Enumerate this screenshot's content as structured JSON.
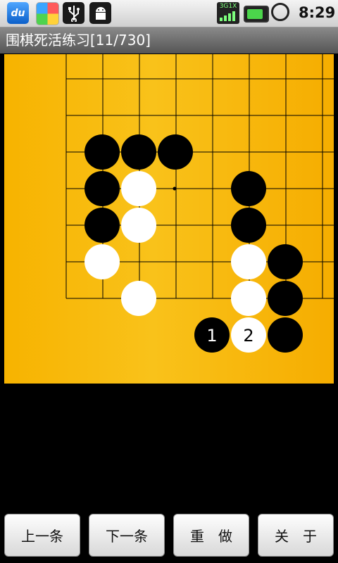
{
  "status_bar": {
    "icons": [
      "du-app-icon",
      "colorful-app-icon",
      "usb-icon",
      "android-debug-icon",
      "3g-signal-icon",
      "battery-charging-icon",
      "alarm-clock-icon"
    ],
    "du_label": "du",
    "signal_label": "3G1X",
    "time": "8:29"
  },
  "title": "围棋死活练习[11/730]",
  "board": {
    "colors": {
      "background": "#f7b300",
      "line": "#000000",
      "black": "#000000",
      "white": "#ffffff"
    },
    "stones": [
      {
        "col": 0,
        "row": 1,
        "color": "black"
      },
      {
        "col": 1,
        "row": 1,
        "color": "black"
      },
      {
        "col": 2,
        "row": 1,
        "color": "black"
      },
      {
        "col": 0,
        "row": 2,
        "color": "black"
      },
      {
        "col": 1,
        "row": 2,
        "color": "white"
      },
      {
        "col": 4,
        "row": 2,
        "color": "black"
      },
      {
        "col": 0,
        "row": 3,
        "color": "black"
      },
      {
        "col": 1,
        "row": 3,
        "color": "white"
      },
      {
        "col": 4,
        "row": 3,
        "color": "black"
      },
      {
        "col": 0,
        "row": 4,
        "color": "white"
      },
      {
        "col": 4,
        "row": 4,
        "color": "white"
      },
      {
        "col": 5,
        "row": 4,
        "color": "black"
      },
      {
        "col": 1,
        "row": 5,
        "color": "white"
      },
      {
        "col": 4,
        "row": 5,
        "color": "white"
      },
      {
        "col": 5,
        "row": 5,
        "color": "black"
      },
      {
        "col": 3,
        "row": 6,
        "color": "black",
        "label": "1"
      },
      {
        "col": 4,
        "row": 6,
        "color": "white",
        "label": "2"
      },
      {
        "col": 5,
        "row": 6,
        "color": "black"
      }
    ]
  },
  "buttons": [
    {
      "name": "prev-button",
      "label": "上一条"
    },
    {
      "name": "next-button",
      "label": "下一条"
    },
    {
      "name": "redo-button",
      "label": "重　做"
    },
    {
      "name": "about-button",
      "label": "关　于"
    }
  ]
}
